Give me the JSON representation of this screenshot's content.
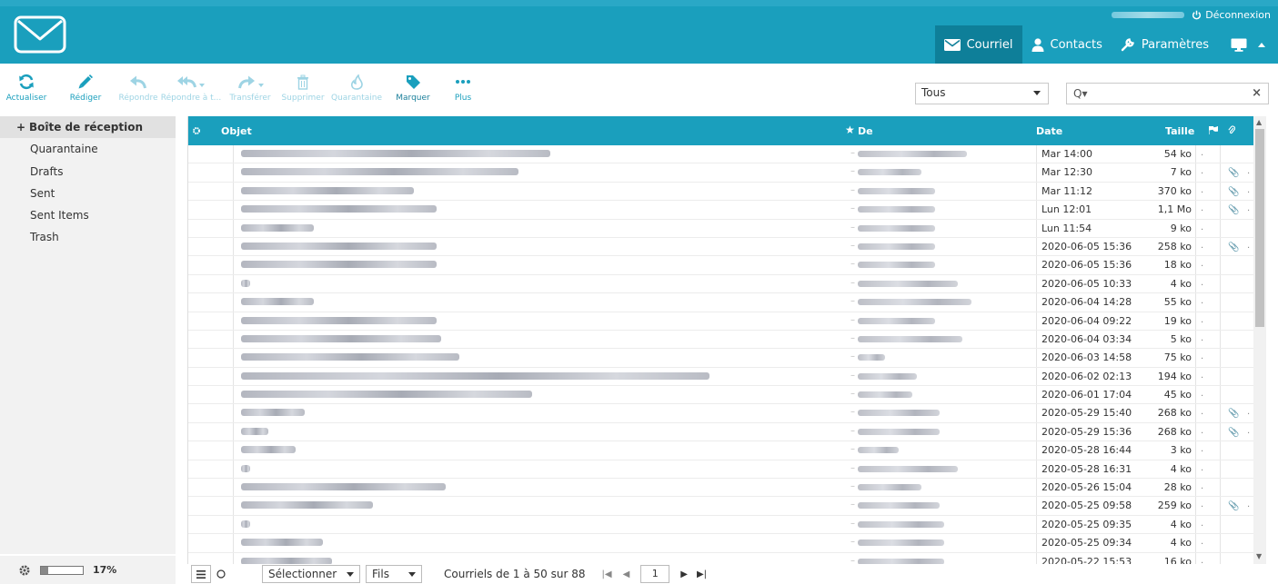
{
  "header": {
    "logout_label": "Déconnexion",
    "nav": [
      {
        "label": "Courriel",
        "icon": "envelope-icon"
      },
      {
        "label": "Contacts",
        "icon": "user-icon"
      },
      {
        "label": "Paramètres",
        "icon": "wrench-icon"
      }
    ]
  },
  "toolbar": {
    "buttons": [
      {
        "label": "Actualiser",
        "icon": "refresh-icon"
      },
      {
        "label": "Rédiger",
        "icon": "pencil-icon"
      },
      {
        "label": "Répondre",
        "icon": "reply-icon"
      },
      {
        "label": "Répondre à t...",
        "icon": "reply-all-icon"
      },
      {
        "label": "Transférer",
        "icon": "forward-icon"
      },
      {
        "label": "Supprimer",
        "icon": "trash-icon"
      },
      {
        "label": "Quarantaine",
        "icon": "flame-icon"
      },
      {
        "label": "Marquer",
        "icon": "tag-icon"
      },
      {
        "label": "Plus",
        "icon": "more-icon"
      }
    ],
    "filter_value": "Tous",
    "search_icon": "Q▾",
    "clear_icon": "×"
  },
  "folders": [
    {
      "label": "Boîte de réception",
      "active": true
    },
    {
      "label": "Quarantaine"
    },
    {
      "label": "Drafts"
    },
    {
      "label": "Sent"
    },
    {
      "label": "Sent Items"
    },
    {
      "label": "Trash"
    }
  ],
  "quota": {
    "percent_label": "17%",
    "fraction": 0.17
  },
  "list": {
    "columns": {
      "subject": "Objet",
      "from": "De",
      "date": "Date",
      "size": "Taille"
    },
    "rows": [
      {
        "date": "Mar 14:00",
        "size": "54 ko",
        "att": false
      },
      {
        "date": "Mar 12:30",
        "size": "7 ko",
        "att": true
      },
      {
        "date": "Mar 11:12",
        "size": "370 ko",
        "att": true
      },
      {
        "date": "Lun 12:01",
        "size": "1,1 Mo",
        "att": true
      },
      {
        "date": "Lun 11:54",
        "size": "9 ko",
        "att": false
      },
      {
        "date": "2020-06-05 15:36",
        "size": "258 ko",
        "att": true
      },
      {
        "date": "2020-06-05 15:36",
        "size": "18 ko",
        "att": false
      },
      {
        "date": "2020-06-05 10:33",
        "size": "4 ko",
        "att": false
      },
      {
        "date": "2020-06-04 14:28",
        "size": "55 ko",
        "att": false
      },
      {
        "date": "2020-06-04 09:22",
        "size": "19 ko",
        "att": false
      },
      {
        "date": "2020-06-04 03:34",
        "size": "5 ko",
        "att": false
      },
      {
        "date": "2020-06-03 14:58",
        "size": "75 ko",
        "att": false
      },
      {
        "date": "2020-06-02 02:13",
        "size": "194 ko",
        "att": false
      },
      {
        "date": "2020-06-01 17:04",
        "size": "45 ko",
        "att": false
      },
      {
        "date": "2020-05-29 15:40",
        "size": "268 ko",
        "att": true
      },
      {
        "date": "2020-05-29 15:36",
        "size": "268 ko",
        "att": true
      },
      {
        "date": "2020-05-28 16:44",
        "size": "3 ko",
        "att": false
      },
      {
        "date": "2020-05-28 16:31",
        "size": "4 ko",
        "att": false
      },
      {
        "date": "2020-05-26 15:04",
        "size": "28 ko",
        "att": false
      },
      {
        "date": "2020-05-25 09:58",
        "size": "259 ko",
        "att": true
      },
      {
        "date": "2020-05-25 09:35",
        "size": "4 ko",
        "att": false
      },
      {
        "date": "2020-05-25 09:34",
        "size": "4 ko",
        "att": false
      },
      {
        "date": "2020-05-22 15:53",
        "size": "16 ko",
        "att": false
      }
    ]
  },
  "footer": {
    "select_label": "Sélectionner",
    "threads_label": "Fils",
    "count_text": "Courriels de 1 à 50 sur 88",
    "page": "1"
  }
}
